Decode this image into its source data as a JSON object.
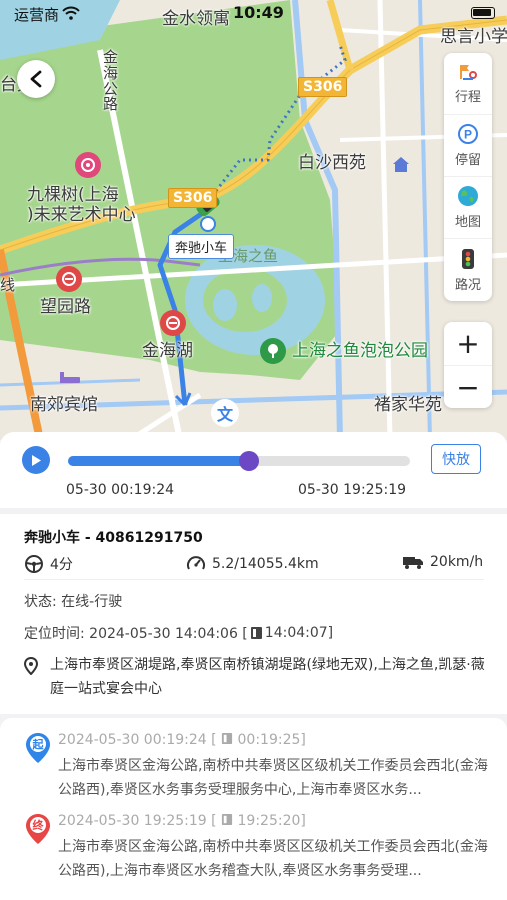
{
  "status_bar": {
    "carrier": "运营商",
    "time": "10:49"
  },
  "map": {
    "labels": {
      "jinshui": "金水领寓",
      "siyan": "思言小学",
      "jinhai_road": "金海\n公路",
      "hege": "台兄阁",
      "baisha": "白沙西苑",
      "jiukeshu": "九棵树(上海\n)未来艺术中心",
      "shanghai_fish": "上海之鱼",
      "wangyuan": "望园路",
      "jinhaihu": "金海湖",
      "bubble_park": "上海之鱼泡泡公园",
      "nanjiao": "南郊宾馆",
      "chujia": "褚家华苑",
      "xian": "线"
    },
    "road_badges": [
      "S306",
      "S306"
    ],
    "car_tag": "奔驰小车",
    "wen_icon": "文",
    "tools": [
      {
        "icon": "trip-icon",
        "label": "行程"
      },
      {
        "icon": "parking-icon",
        "label": "停留"
      },
      {
        "icon": "globe-icon",
        "label": "地图"
      },
      {
        "icon": "traffic-light-icon",
        "label": "路况"
      }
    ],
    "zoom_in": "+",
    "zoom_out": "−"
  },
  "playback": {
    "speed_label": "快放",
    "start_time": "05-30 00:19:24",
    "end_time": "05-30 19:25:19",
    "progress": 0.53
  },
  "vehicle": {
    "title": "奔驰小车 - 40861291750",
    "duration": "4分",
    "mileage": "5.2/14055.4km",
    "speed": "20km/h",
    "status": "状态:  在线-行驶",
    "location_time": "定位时间:  2024-05-30 14:04:06  [",
    "location_time_gps": "14:04:07]",
    "address": "上海市奉贤区湖堤路,奉贤区南桥镇湖堤路(绿地无双),上海之鱼,凯瑟·薇庭一站式宴会中心"
  },
  "timeline": {
    "start": {
      "pin_label": "起",
      "time": "2024-05-30 00:19:24  [",
      "gps_time": "00:19:25]",
      "address": "上海市奉贤区金海公路,南桥中共奉贤区区级机关工作委员会西北(金海公路西),奉贤区水务事务受理服务中心,上海市奉贤区水务..."
    },
    "end": {
      "pin_label": "终",
      "time": "2024-05-30 19:25:19  [",
      "gps_time": "19:25:20]",
      "address": "上海市奉贤区金海公路,南桥中共奉贤区区级机关工作委员会西北(金海公路西),上海市奉贤区水务稽查大队,奉贤区水务事务受理..."
    }
  },
  "colors": {
    "accent": "#3b82e6",
    "thumb": "#6d48c4",
    "start_pin": "#2f86e8",
    "end_pin": "#e84545"
  }
}
